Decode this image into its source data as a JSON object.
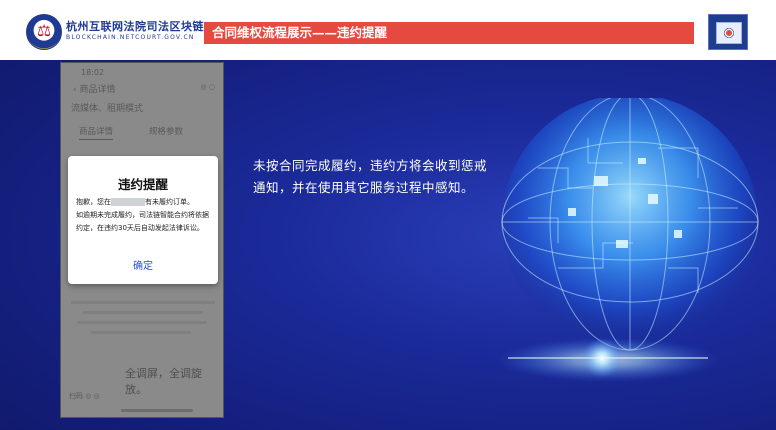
{
  "header": {
    "org_name": "杭州互联网法院司法区块链",
    "org_domain": "BLOCKCHAIN.NETCOURT.GOV.CN",
    "title": "合同维权流程展示——违约提醒"
  },
  "phone": {
    "time": "18:02",
    "status": "◎ ○",
    "page_header": "‹  商品详情",
    "subtitle": "流媒体、租期模式",
    "tab_left": "商品详情",
    "tab_right": "规格参数",
    "promo_text": "全调屏，全调旋放。",
    "footer_text": "扫码  ◎  ◎"
  },
  "dialog": {
    "title": "违约提醒",
    "line1_prefix": "抱歉，您在",
    "line1_suffix": "有未履约订单。",
    "line2": "如逾期未完成履约，司法链智能合约将依据约定，在违约30天后自动发起法律诉讼。",
    "confirm": "确定"
  },
  "description": "未按合同完成履约，违约方将会收到惩戒通知，并在使用其它服务过程中感知。"
}
